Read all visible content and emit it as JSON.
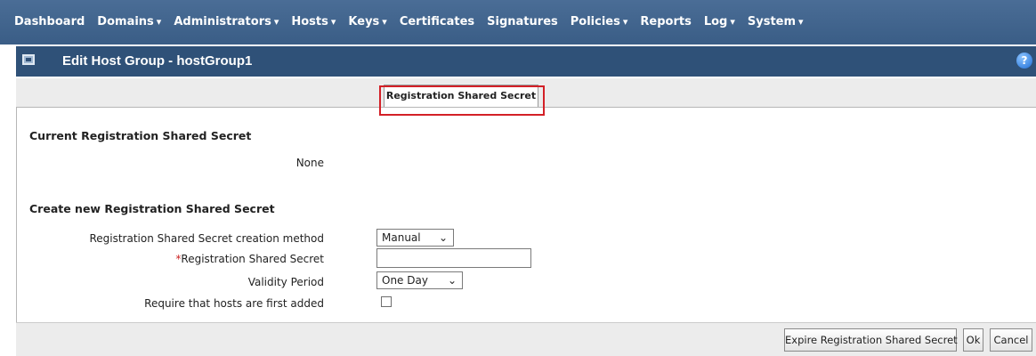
{
  "nav": {
    "items": [
      {
        "label": "Dashboard",
        "caret": ""
      },
      {
        "label": "Domains",
        "caret": "▾"
      },
      {
        "label": "Administrators",
        "caret": "▾"
      },
      {
        "label": "Hosts",
        "caret": "▾"
      },
      {
        "label": "Keys",
        "caret": "▾"
      },
      {
        "label": "Certificates",
        "caret": ""
      },
      {
        "label": "Signatures",
        "caret": ""
      },
      {
        "label": "Policies",
        "caret": "▾"
      },
      {
        "label": "Reports",
        "caret": ""
      },
      {
        "label": "Log",
        "caret": "▾"
      },
      {
        "label": "System",
        "caret": "▾"
      }
    ]
  },
  "titlebar": {
    "title": "Edit Host Group - hostGroup1",
    "help_label": "?",
    "icon": "window-icon"
  },
  "tabs": {
    "active_label": "Registration Shared Secret"
  },
  "current": {
    "heading": "Current Registration Shared Secret",
    "value": "None"
  },
  "create": {
    "heading": "Create new Registration Shared Secret",
    "method_label": "Registration Shared Secret creation method",
    "method_value": "Manual",
    "secret_required_mark": "*",
    "secret_label": "Registration Shared Secret",
    "secret_value": "",
    "validity_label": "Validity Period",
    "validity_value": "One Day",
    "require_label": "Require that hosts are first added",
    "require_checked": false
  },
  "footer": {
    "expire_label": "Expire Registration Shared Secret",
    "ok_label": "Ok",
    "cancel_label": "Cancel"
  },
  "colors": {
    "nav_bg": "#3f6390",
    "titlebar_bg": "#2f5178",
    "highlight": "#d32027",
    "required": "#cc2222"
  }
}
